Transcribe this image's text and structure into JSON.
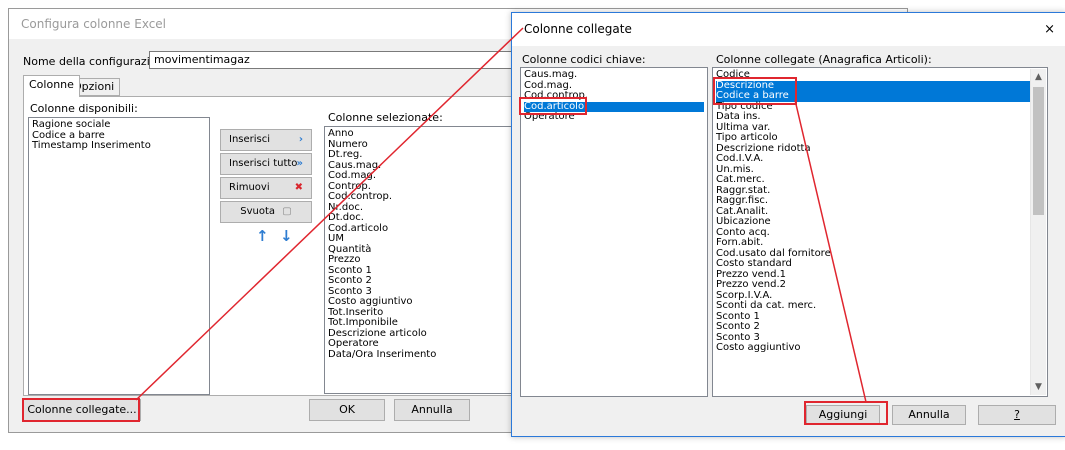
{
  "back_dialog": {
    "title": "Configura colonne Excel",
    "config_name_label": "Nome della configurazione:",
    "config_name_value": "movimentimagaz",
    "tabs": [
      {
        "label": "Colonne"
      },
      {
        "label": "Opzioni"
      }
    ],
    "available_label": "Colonne disponibili:",
    "available_items": [
      "Ragione sociale",
      "Codice a barre",
      "Timestamp Inserimento"
    ],
    "selected_label": "Colonne selezionate:",
    "selected_items": [
      "Anno",
      "Numero",
      "Dt.reg.",
      "Caus.mag.",
      "Cod.mag.",
      "Controp.",
      "Cod.controp.",
      "Nr.doc.",
      "Dt.doc.",
      "Cod.articolo",
      "UM",
      "Quantità",
      "Prezzo",
      "Sconto 1",
      "Sconto 2",
      "Sconto 3",
      "Costo aggiuntivo",
      "Tot.Inserito",
      "Tot.Imponibile",
      "Descrizione articolo",
      "Operatore",
      "Data/Ora Inserimento"
    ],
    "buttons": {
      "inserisci": "Inserisci",
      "inserisci_tutto": "Inserisci tutto",
      "rimuovi": "Rimuovi",
      "svuota": "Svuota",
      "colonne_collegate": "Colonne collegate...",
      "ok": "OK",
      "annulla": "Annulla"
    },
    "icons": {
      "insert": "chevron-right-icon",
      "insert_all": "double-chevron-right-icon",
      "remove": "remove-icon",
      "clear": "page-icon",
      "move_up": "arrow-up-icon",
      "move_down": "arrow-down-icon"
    }
  },
  "front_dialog": {
    "title": "Colonne collegate",
    "close_symbol": "×",
    "keys_label": "Colonne codici chiave:",
    "keys_items": [
      "Caus.mag.",
      "Cod.mag.",
      "Cod.controp.",
      "Cod.articolo",
      "Operatore"
    ],
    "keys_selected": "Cod.articolo",
    "linked_label": "Colonne collegate (Anagrafica Articoli):",
    "linked_items": [
      "Codice",
      "Descrizione",
      "Codice a barre",
      "Tipo codice",
      "Data ins.",
      "Ultima var.",
      "Tipo articolo",
      "Descrizione ridotta",
      "Cod.I.V.A.",
      "Un.mis.",
      "Cat.merc.",
      "Raggr.stat.",
      "Raggr.fisc.",
      "Cat.Analit.",
      "Ubicazione",
      "Conto acq.",
      "Forn.abit.",
      "Cod.usato dal fornitore",
      "Costo standard",
      "Prezzo vend.1",
      "Prezzo vend.2",
      "Scorp.I.V.A.",
      "Sconti da cat. merc.",
      "Sconto 1",
      "Sconto 2",
      "Sconto 3",
      "Costo aggiuntivo"
    ],
    "linked_selected": [
      "Descrizione",
      "Codice a barre"
    ],
    "buttons": {
      "aggiungi": "Aggiungi",
      "annulla": "Annulla",
      "help": "?"
    }
  },
  "colors": {
    "selection": "#0078d7",
    "highlight_red": "#e0262f",
    "dialog_border": "#2b79d9"
  }
}
